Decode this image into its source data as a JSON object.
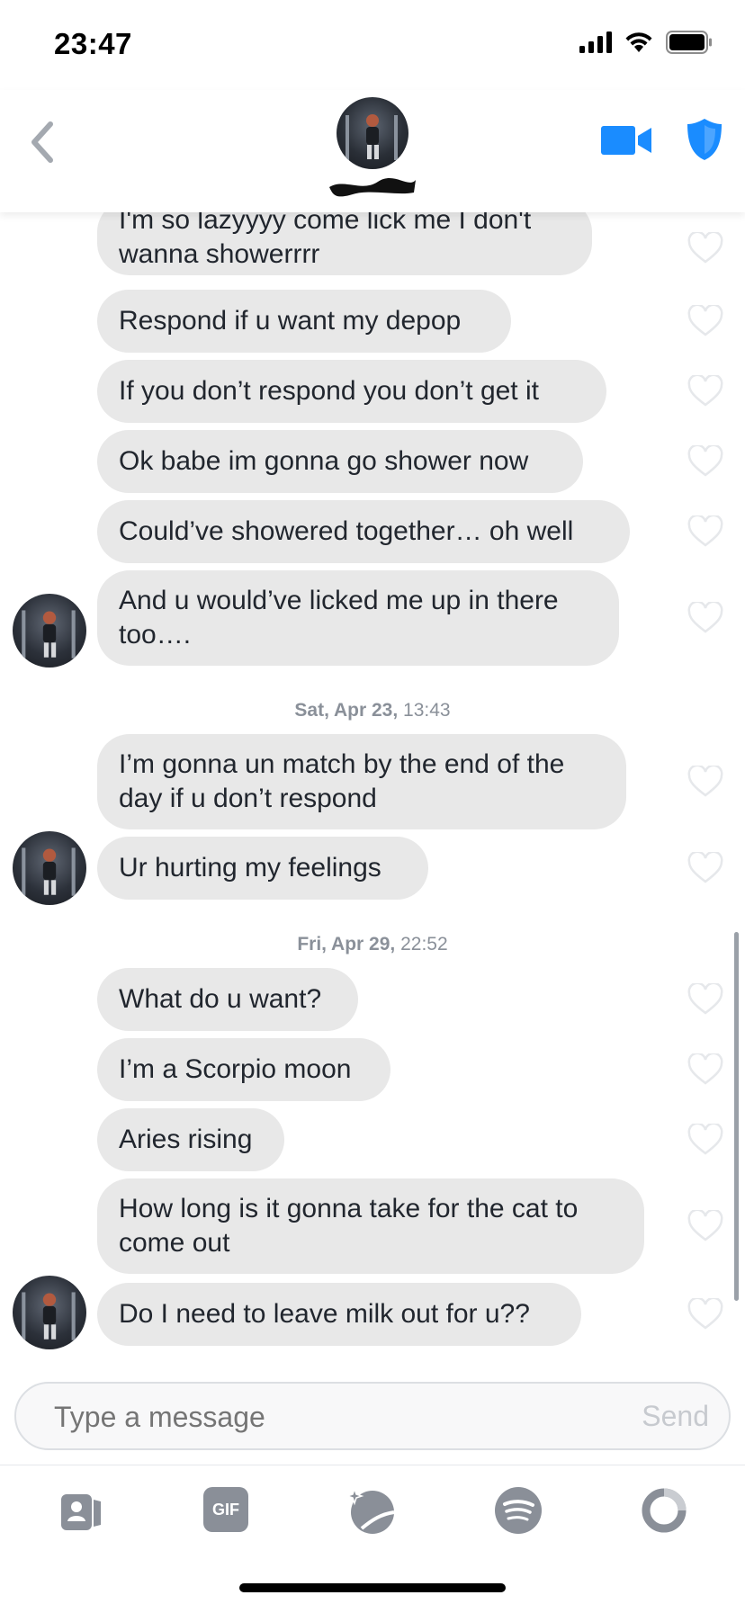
{
  "status_bar": {
    "time": "23:47"
  },
  "colors": {
    "accent": "#1a8cff",
    "bubble": "#e8e8e8",
    "icon_gray": "#8a8f98"
  },
  "header": {
    "back_icon": "chevron-left-icon",
    "video_icon": "video-camera-icon",
    "safety_icon": "shield-icon"
  },
  "messages": [
    {
      "text": "I'm so lazyyyy come lick me I don't\nwanna showerrrr"
    },
    {
      "text": "Respond if u want my depop"
    },
    {
      "text": "If you don’t respond you don’t get it"
    },
    {
      "text": "Ok babe im gonna go shower now"
    },
    {
      "text": "Could’ve showered together… oh well"
    },
    {
      "text": "And u would’ve licked me up in there\ntoo…."
    },
    {
      "text": "I’m gonna un match by the end of the\nday if u don’t respond"
    },
    {
      "text": "Ur hurting my feelings"
    },
    {
      "text": "What do u want?"
    },
    {
      "text": "I’m a Scorpio moon"
    },
    {
      "text": "Aries rising"
    },
    {
      "text": "How long is it gonna take for the cat to\ncome out"
    },
    {
      "text": "Do I need to leave milk out for u??"
    }
  ],
  "date_separators": [
    {
      "day": "Sat, Apr 23,",
      "time": "13:43"
    },
    {
      "day": "Fri, Apr 29,",
      "time": "22:52"
    }
  ],
  "composer": {
    "placeholder": "Type a message",
    "send_label": "Send"
  },
  "toolbar": {
    "gif_label": "GIF",
    "items": [
      "contact-card-icon",
      "gif-icon",
      "sticker-icon",
      "spotify-icon",
      "loading-ring-icon"
    ]
  }
}
